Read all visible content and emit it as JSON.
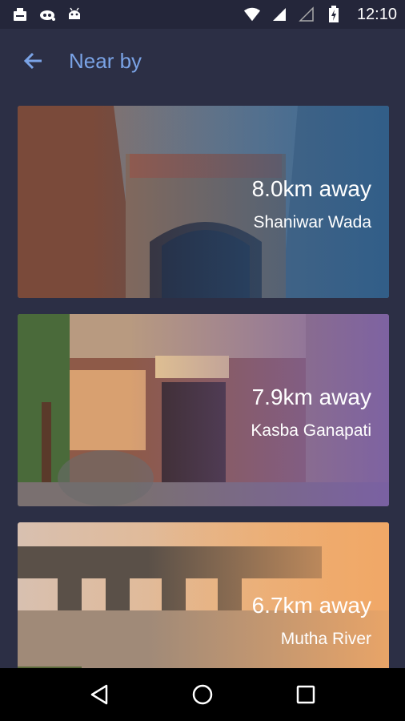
{
  "status_bar": {
    "time": "12:10",
    "left_icons": [
      "inbox-icon",
      "ufo-icon",
      "android-icon"
    ],
    "right_icons": [
      "wifi-icon",
      "signal-icon",
      "signal-empty-icon",
      "battery-charging-icon"
    ]
  },
  "app_bar": {
    "title": "Near by",
    "back_icon": "arrow-left-icon"
  },
  "places": [
    {
      "distance": "8.0km away",
      "name": "Shaniwar Wada",
      "tint": "#2a5c8a"
    },
    {
      "distance": "7.9km away",
      "name": "Kasba Ganapati",
      "tint": "#7a5fa8"
    },
    {
      "distance": "6.7km away",
      "name": "Mutha River",
      "tint": "#f0a766"
    }
  ],
  "nav_bar": {
    "back_icon": "triangle-back-icon",
    "home_icon": "circle-home-icon",
    "recents_icon": "square-recents-icon"
  },
  "colors": {
    "background": "#2c2f45",
    "accent": "#7aa3e6",
    "status_bar": "#24263a"
  }
}
